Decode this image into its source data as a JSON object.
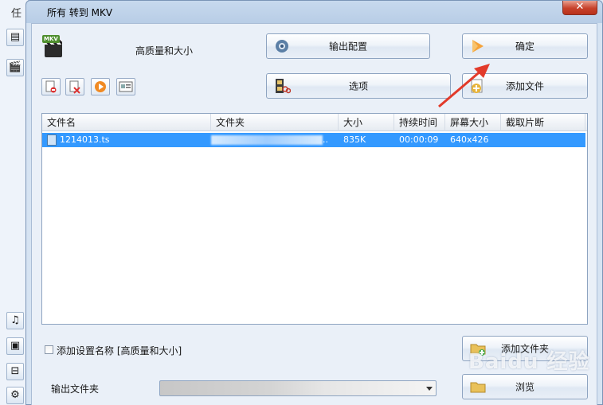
{
  "background_app": {
    "title_char": "任"
  },
  "dialog": {
    "title": "所有 转到 MKV"
  },
  "profile": {
    "label": "高质量和大小",
    "icon_tag": "MKV"
  },
  "buttons": {
    "output_config": "输出配置",
    "ok": "确定",
    "options": "选项",
    "add_file": "添加文件",
    "add_folder": "添加文件夹",
    "browse": "浏览"
  },
  "file_list": {
    "columns": [
      "文件名",
      "文件夹",
      "大小",
      "持续时间",
      "屏幕大小",
      "截取片断"
    ],
    "rows": [
      {
        "name": "1214013.ts",
        "folder": "..",
        "size": "835K",
        "duration": "00:00:09",
        "screen": "640x426",
        "clip": ""
      }
    ]
  },
  "add_setting_name": {
    "label": "添加设置名称 [高质量和大小]",
    "checked": false
  },
  "output_folder": {
    "label": "输出文件夹",
    "value": ""
  },
  "watermark": "Baidu 经验"
}
